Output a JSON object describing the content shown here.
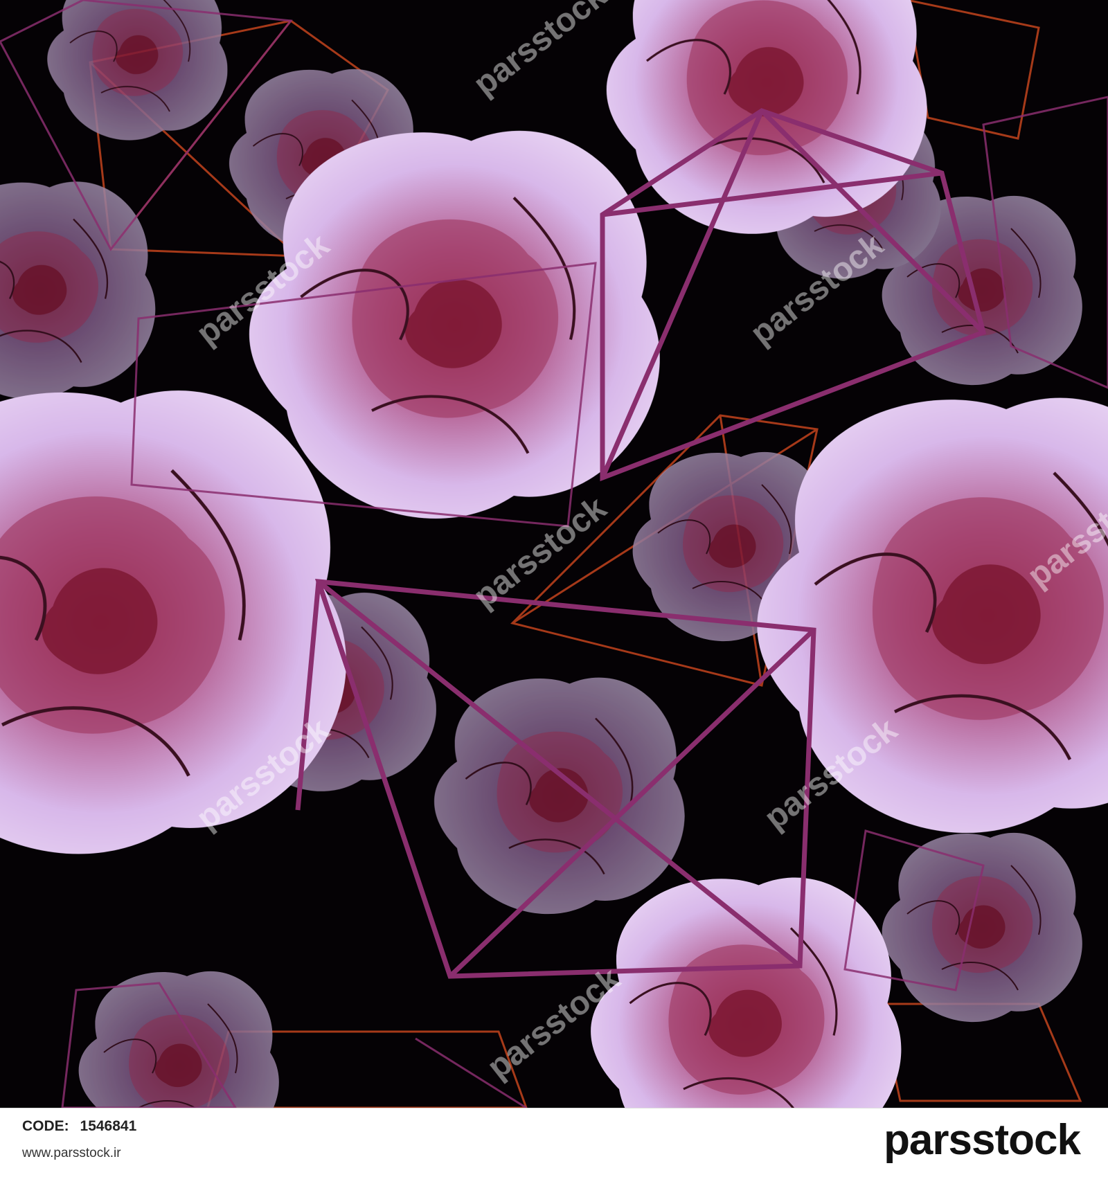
{
  "image": {
    "description_colors": {
      "background": "#050205",
      "rose_light": "#d8b8ea",
      "rose_mid": "#b25a8c",
      "rose_dark": "#8c1e3c",
      "line_purple": "#8a2e6e",
      "line_orange": "#b8401c"
    },
    "watermark_text": "parsstock"
  },
  "footer": {
    "code_label": "CODE:",
    "code_value": "1546841",
    "url": "www.parsstock.ir",
    "brand": "parsstock"
  }
}
